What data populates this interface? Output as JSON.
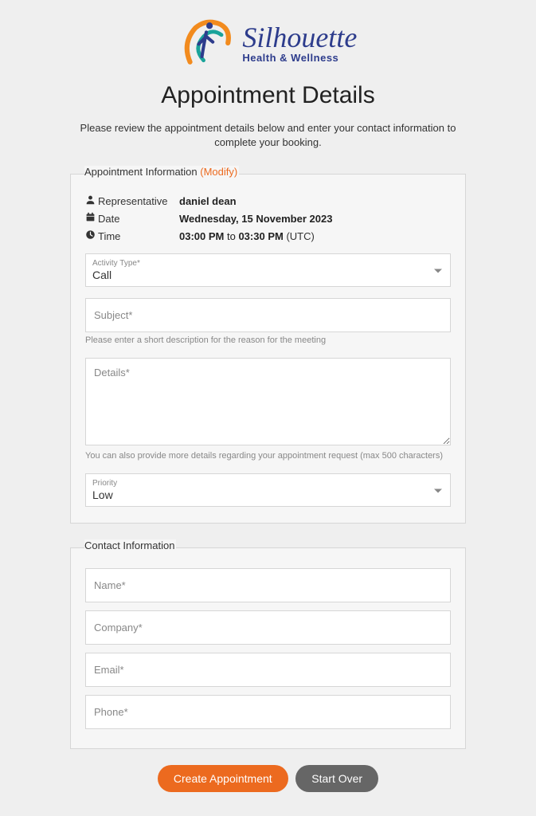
{
  "logo": {
    "brand": "Silhouette",
    "sub": "Health & Wellness",
    "colors": {
      "swoosh": "#f28b1e",
      "swirl": "#1aa39a",
      "text": "#2d3c8c"
    }
  },
  "page": {
    "title": "Appointment Details",
    "subtitle": "Please review the appointment details below and enter your contact information to complete your booking."
  },
  "apptSection": {
    "legend": "Appointment Information",
    "modify": "(Modify)",
    "rows": {
      "rep": {
        "label": "Representative",
        "value": "daniel dean"
      },
      "date": {
        "label": "Date",
        "value": "Wednesday, 15 November 2023"
      },
      "time": {
        "label": "Time",
        "start": "03:00 PM",
        "to": " to ",
        "end": "03:30 PM",
        "tz": " (UTC)"
      }
    },
    "activityType": {
      "label": "Activity Type*",
      "value": "Call"
    },
    "subject": {
      "placeholder": "Subject*",
      "value": ""
    },
    "subjectHint": "Please enter a short description for the reason for the meeting",
    "details": {
      "placeholder": "Details*",
      "value": ""
    },
    "detailsHint": "You can also provide more details regarding your appointment request (max 500 characters)",
    "priority": {
      "label": "Priority",
      "value": "Low"
    }
  },
  "contactSection": {
    "legend": "Contact Information",
    "name": {
      "placeholder": "Name*",
      "value": ""
    },
    "company": {
      "placeholder": "Company*",
      "value": ""
    },
    "email": {
      "placeholder": "Email*",
      "value": ""
    },
    "phone": {
      "placeholder": "Phone*",
      "value": ""
    }
  },
  "buttons": {
    "create": "Create Appointment",
    "startOver": "Start Over"
  }
}
